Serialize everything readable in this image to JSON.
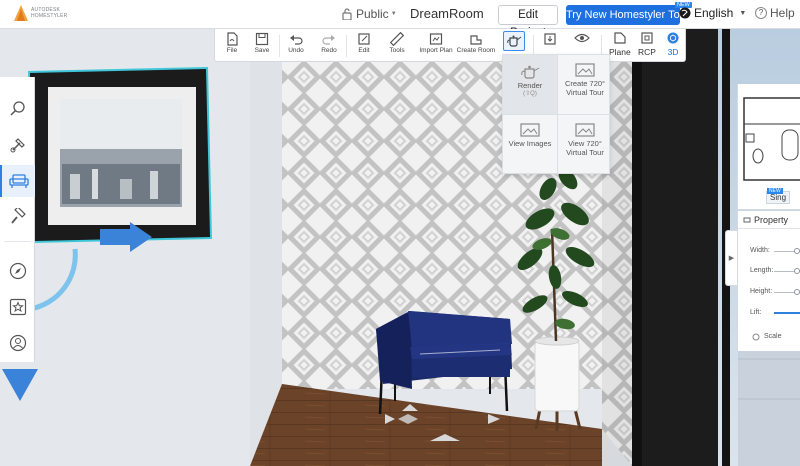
{
  "app": {
    "logo_text_line1": "AUTODESK",
    "logo_text_line2": "HOMESTYLER",
    "privacy": "Public",
    "project_name": "DreamRoom",
    "edit_project": "Edit Project",
    "try_new": "Try New Homestyler Tool",
    "new_badge": "NEW",
    "language": "English",
    "help": "Help"
  },
  "toolbar": {
    "file": "File",
    "save": "Save",
    "undo": "Undo",
    "redo": "Redo",
    "edit": "Edit",
    "tools": "Tools",
    "import_plan": "Import Plan",
    "create_room": "Create Room",
    "plane": "Plane",
    "rcp": "RCP",
    "view3d": "3D"
  },
  "render_menu": {
    "render": "Render",
    "render_shortcut": "(⇧Q)",
    "create_720_line1": "Create 720°",
    "create_720_line2": "Virtual Tour",
    "view_images": "View Images",
    "view_720_line1": "View 720°",
    "view_720_line2": "Virtual Tour"
  },
  "sidebar": {
    "items": [
      "search-icon",
      "hammer-icon",
      "armchair-icon",
      "paint-roller-icon",
      "compass-icon",
      "star-icon",
      "user-icon"
    ]
  },
  "property_panel": {
    "floorplan_badge": "NEW",
    "floorplan_name": "Sing",
    "title": "Property",
    "width_label": "Width:",
    "length_label": "Length:",
    "height_label": "Height:",
    "lift_label": "Lift:",
    "scale_label": "Scale"
  },
  "colors": {
    "accent": "#1e6fe0",
    "armchair": "#1b2a6b",
    "floor": "#6a4227"
  }
}
